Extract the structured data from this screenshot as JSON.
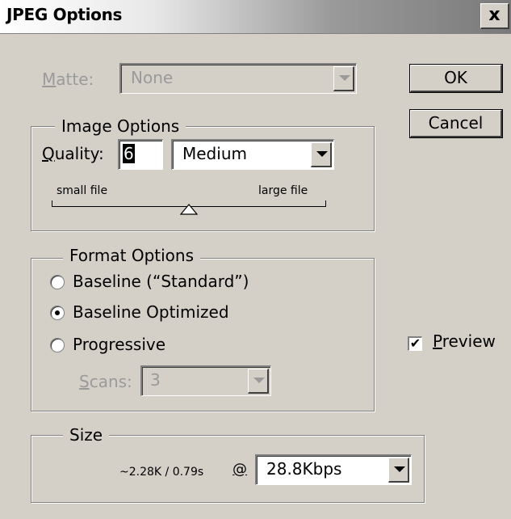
{
  "window": {
    "title": "JPEG Options",
    "close_label": "x"
  },
  "matte": {
    "label_underlined": "M",
    "label_rest": "atte:",
    "value": "None"
  },
  "buttons": {
    "ok": "OK",
    "cancel": "Cancel"
  },
  "image_options": {
    "title": "Image Options",
    "quality_label_underlined": "Q",
    "quality_label_rest": "uality:",
    "quality_value": "6",
    "quality_preset": "Medium",
    "slider_left": "small file",
    "slider_right": "large file",
    "slider_level_of_12": 6
  },
  "format_options": {
    "title": "Format Options",
    "radios": [
      {
        "label": "Baseline (“Standard”)",
        "selected": false
      },
      {
        "label": "Baseline Optimized",
        "selected": true
      },
      {
        "label": "Progressive",
        "selected": false
      }
    ],
    "scans_label_underlined": "S",
    "scans_label_rest": "cans:",
    "scans_value": "3"
  },
  "preview": {
    "label_underlined": "P",
    "label_rest": "review",
    "checked": true,
    "check_glyph": "✔"
  },
  "size": {
    "title": "Size",
    "estimate": "~2.28K / 0.79s",
    "at_symbol": "@",
    "speed": "28.8Kbps"
  }
}
